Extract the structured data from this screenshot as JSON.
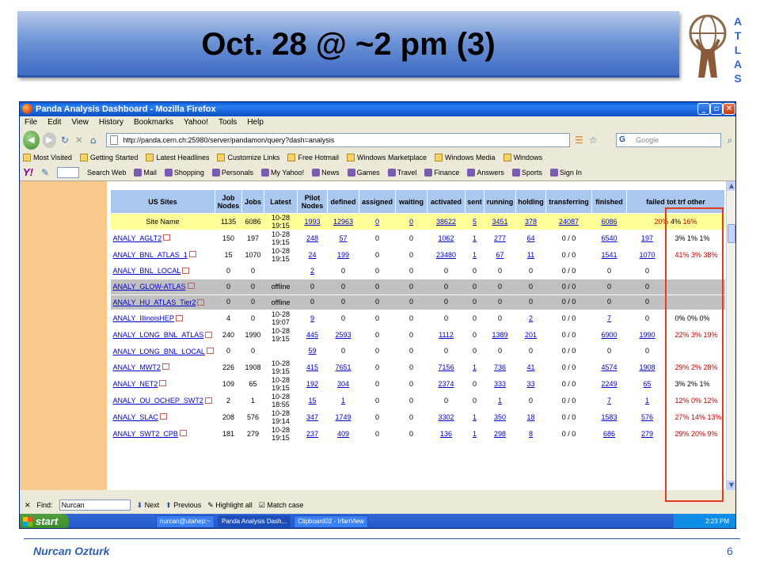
{
  "slide": {
    "title": "Oct. 28 @ ~2 pm (3)",
    "author": "Nurcan Ozturk",
    "page_number": "6",
    "logo_letters": [
      "A",
      "T",
      "L",
      "A",
      "S"
    ]
  },
  "window": {
    "title": "Panda Analysis Dashboard - Mozilla Firefox",
    "menu": [
      "File",
      "Edit",
      "View",
      "History",
      "Bookmarks",
      "Yahoo!",
      "Tools",
      "Help"
    ],
    "url": "http://panda.cern.ch:25980/server/pandamon/query?dash=analysis",
    "search_placeholder": "Google",
    "bookmarks": [
      "Most Visited",
      "Getting Started",
      "Latest Headlines",
      "Customize Links",
      "Free Hotmail",
      "Windows Marketplace",
      "Windows Media",
      "Windows"
    ],
    "yahoo_logo": "Y!",
    "yahoo_items": [
      "Search Web",
      "Mail",
      "Shopping",
      "Personals",
      "My Yahoo!",
      "News",
      "Games",
      "Travel",
      "Finance",
      "Answers",
      "Sports",
      "Sign In"
    ]
  },
  "table": {
    "headers": [
      "US Sites",
      "Job Nodes",
      "Jobs",
      "Latest",
      "Pilot Nodes",
      "defined",
      "assigned",
      "waiting",
      "activated",
      "sent",
      "running",
      "holding",
      "transferring",
      "finished",
      "failed tot trf other"
    ],
    "total_row": {
      "site": "Site Name",
      "job_nodes": "1135",
      "jobs": "6086",
      "latest_date": "10-28",
      "latest_time": "19:15",
      "pilot_nodes": "1993",
      "defined": "12963",
      "assigned": "0",
      "waiting": "0",
      "activated": "38622",
      "sent": "5",
      "running": "3451",
      "holding": "378",
      "transferring": "24087",
      "finished": "6086",
      "failed_tot": "20%",
      "failed_trf": "4%",
      "failed_other": "16%"
    },
    "rows": [
      {
        "site": "ANALY_AGLT2",
        "job_nodes": "150",
        "jobs": "197",
        "latest_date": "10-28",
        "latest_time": "19:15",
        "pilot_nodes": "248",
        "defined": "57",
        "assigned": "0",
        "waiting": "0",
        "activated": "1062",
        "sent": "1",
        "running": "277",
        "holding": "64",
        "transferring": "0 / 0",
        "finished": "6540",
        "failed": "197",
        "failed_pct": "3% 1% 1%",
        "pct_red": false
      },
      {
        "site": "ANALY_BNL_ATLAS_1",
        "job_nodes": "15",
        "jobs": "1070",
        "latest_date": "10-28",
        "latest_time": "19:15",
        "pilot_nodes": "24",
        "defined": "199",
        "assigned": "0",
        "waiting": "0",
        "activated": "23480",
        "sent": "1",
        "running": "67",
        "holding": "11",
        "transferring": "0 / 0",
        "finished": "1541",
        "failed": "1070",
        "failed_pct": "41% 3% 38%",
        "pct_red": true
      },
      {
        "site": "ANALY_BNL_LOCAL",
        "job_nodes": "0",
        "jobs": "0",
        "latest_date": "",
        "latest_time": "",
        "pilot_nodes": "2",
        "defined": "0",
        "assigned": "0",
        "waiting": "0",
        "activated": "0",
        "sent": "0",
        "running": "0",
        "holding": "0",
        "transferring": "0 / 0",
        "finished": "0",
        "failed": "0",
        "failed_pct": "",
        "pct_red": false
      },
      {
        "site": "ANALY_GLOW-ATLAS",
        "offline": true,
        "job_nodes": "0",
        "jobs": "0",
        "latest_date": "offline",
        "latest_time": "",
        "pilot_nodes": "0",
        "defined": "0",
        "assigned": "0",
        "waiting": "0",
        "activated": "0",
        "sent": "0",
        "running": "0",
        "holding": "0",
        "transferring": "0 / 0",
        "finished": "0",
        "failed": "0",
        "failed_pct": "",
        "pct_red": false
      },
      {
        "site": "ANALY_HU_ATLAS_Tier2",
        "offline": true,
        "job_nodes": "0",
        "jobs": "0",
        "latest_date": "offline",
        "latest_time": "",
        "pilot_nodes": "0",
        "defined": "0",
        "assigned": "0",
        "waiting": "0",
        "activated": "0",
        "sent": "0",
        "running": "0",
        "holding": "0",
        "transferring": "0 / 0",
        "finished": "0",
        "failed": "0",
        "failed_pct": "",
        "pct_red": false
      },
      {
        "site": "ANALY_IllinoisHEP",
        "job_nodes": "4",
        "jobs": "0",
        "latest_date": "10-28",
        "latest_time": "19:07",
        "pilot_nodes": "9",
        "defined": "0",
        "assigned": "0",
        "waiting": "0",
        "activated": "0",
        "sent": "0",
        "running": "0",
        "holding": "2",
        "transferring": "0 / 0",
        "finished": "7",
        "failed": "0",
        "failed_pct": "0% 0% 0%",
        "pct_red": false
      },
      {
        "site": "ANALY_LONG_BNL_ATLAS",
        "job_nodes": "240",
        "jobs": "1990",
        "latest_date": "10-28",
        "latest_time": "19:15",
        "pilot_nodes": "445",
        "defined": "2593",
        "assigned": "0",
        "waiting": "0",
        "activated": "1112",
        "sent": "0",
        "running": "1389",
        "holding": "201",
        "transferring": "0 / 0",
        "finished": "6900",
        "failed": "1990",
        "failed_pct": "22% 3% 19%",
        "pct_red": true
      },
      {
        "site": "ANALY_LONG_BNL_LOCAL",
        "job_nodes": "0",
        "jobs": "0",
        "latest_date": "",
        "latest_time": "",
        "pilot_nodes": "59",
        "defined": "0",
        "assigned": "0",
        "waiting": "0",
        "activated": "0",
        "sent": "0",
        "running": "0",
        "holding": "0",
        "transferring": "0 / 0",
        "finished": "0",
        "failed": "0",
        "failed_pct": "",
        "pct_red": false
      },
      {
        "site": "ANALY_MWT2",
        "job_nodes": "226",
        "jobs": "1908",
        "latest_date": "10-28",
        "latest_time": "19:15",
        "pilot_nodes": "415",
        "defined": "7651",
        "assigned": "0",
        "waiting": "0",
        "activated": "7156",
        "sent": "1",
        "running": "736",
        "holding": "41",
        "transferring": "0 / 0",
        "finished": "4574",
        "failed": "1908",
        "failed_pct": "29% 2% 28%",
        "pct_red": true
      },
      {
        "site": "ANALY_NET2",
        "job_nodes": "109",
        "jobs": "65",
        "latest_date": "10-28",
        "latest_time": "19:15",
        "pilot_nodes": "192",
        "defined": "304",
        "assigned": "0",
        "waiting": "0",
        "activated": "2374",
        "sent": "0",
        "running": "333",
        "holding": "33",
        "transferring": "0 / 0",
        "finished": "2249",
        "failed": "65",
        "failed_pct": "3% 2% 1%",
        "pct_red": false
      },
      {
        "site": "ANALY_OU_OCHEP_SWT2",
        "job_nodes": "2",
        "jobs": "1",
        "latest_date": "10-28",
        "latest_time": "18:55",
        "pilot_nodes": "15",
        "defined": "1",
        "assigned": "0",
        "waiting": "0",
        "activated": "0",
        "sent": "0",
        "running": "1",
        "holding": "0",
        "transferring": "0 / 0",
        "finished": "7",
        "failed": "1",
        "failed_pct": "12% 0% 12%",
        "pct_red": true
      },
      {
        "site": "ANALY_SLAC",
        "job_nodes": "208",
        "jobs": "576",
        "latest_date": "10-28",
        "latest_time": "19:14",
        "pilot_nodes": "347",
        "defined": "1749",
        "assigned": "0",
        "waiting": "0",
        "activated": "3302",
        "sent": "1",
        "running": "350",
        "holding": "18",
        "transferring": "0 / 0",
        "finished": "1583",
        "failed": "576",
        "failed_pct": "27% 14% 13%",
        "pct_red": true
      },
      {
        "site": "ANALY_SWT2_CPB",
        "job_nodes": "181",
        "jobs": "279",
        "latest_date": "10-28",
        "latest_time": "19:15",
        "pilot_nodes": "237",
        "defined": "409",
        "assigned": "0",
        "waiting": "0",
        "activated": "136",
        "sent": "1",
        "running": "298",
        "holding": "8",
        "transferring": "0 / 0",
        "finished": "686",
        "failed": "279",
        "failed_pct": "29% 20% 9%",
        "pct_red": true
      }
    ]
  },
  "findbar": {
    "label": "Find:",
    "value": "Nurcan",
    "next": "Next",
    "previous": "Previous",
    "highlight": "Highlight all",
    "match_case": "Match case"
  },
  "taskbar": {
    "start": "start",
    "tasks": [
      "nurcan@utahep:~",
      "Panda Analysis Dash...",
      "Clipboard02 - IrfanView"
    ],
    "clock": "2:23 PM"
  },
  "colors": {
    "title_gradient": "#3e6cc4",
    "table_header": "#aac7ee",
    "total_row": "#ffff99",
    "offline_row": "#c0c0c0",
    "left_panel": "#f8c98a",
    "highlight_box": "#e23b22",
    "failed_red": "#cc0000"
  }
}
